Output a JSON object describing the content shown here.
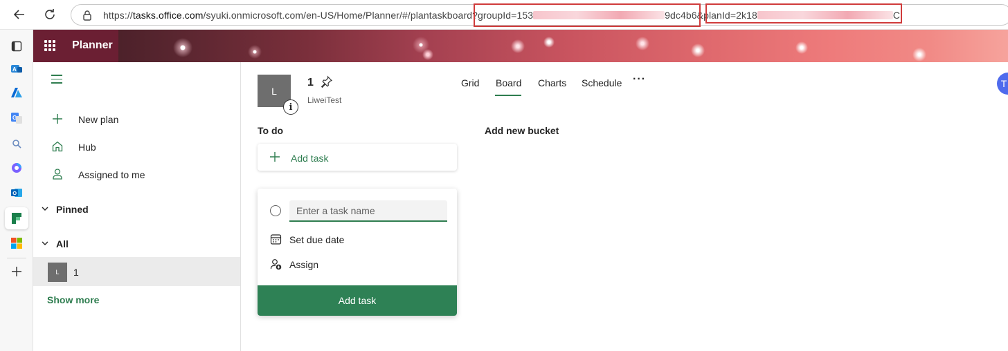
{
  "browser": {
    "url": {
      "scheme": "https://",
      "host": "tasks.office.com",
      "path": "/syuki.onmicrosoft.com/en-US/Home/Planner/#/plantaskboard?",
      "group_param_prefix": "groupId=153",
      "group_param_suffix": "9dc4b6&",
      "plan_param_prefix": "planId=2k18",
      "plan_param_suffix": "C"
    }
  },
  "app": {
    "title": "Planner"
  },
  "left_nav": {
    "items": [
      {
        "label": "New plan"
      },
      {
        "label": "Hub"
      },
      {
        "label": "Assigned to me"
      }
    ],
    "pinned_label": "Pinned",
    "all_label": "All",
    "plans": [
      {
        "initial": "L",
        "name": "1"
      }
    ],
    "show_more": "Show more"
  },
  "plan": {
    "initial": "L",
    "title": "1",
    "group": "LiweiTest"
  },
  "tabs": [
    {
      "label": "Grid"
    },
    {
      "label": "Board"
    },
    {
      "label": "Charts"
    },
    {
      "label": "Schedule"
    }
  ],
  "active_tab": "Board",
  "more_label": "···",
  "profile_initial": "T",
  "board": {
    "bucket_name": "To do",
    "add_bucket": "Add new bucket",
    "add_task_label": "Add task",
    "new_task": {
      "placeholder": "Enter a task name",
      "due_date_label": "Set due date",
      "assign_label": "Assign",
      "submit_label": "Add task"
    }
  },
  "colors": {
    "accent": "#2e7d4f",
    "header_left": "#6b1f33",
    "highlight_box": "#d03b3b"
  }
}
